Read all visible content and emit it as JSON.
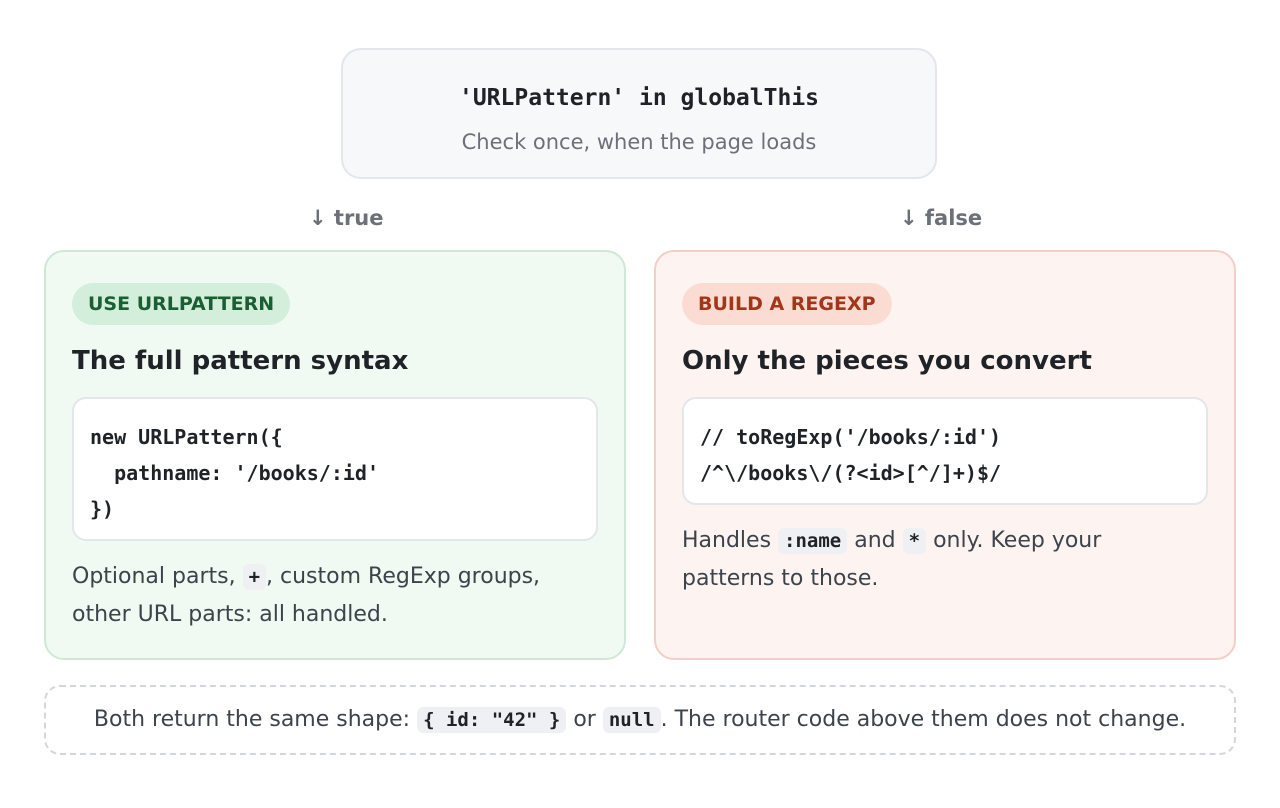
{
  "top": {
    "code": "'URLPattern' in globalThis",
    "subtitle": "Check once, when the page loads"
  },
  "branches": {
    "true_label": "↓ true",
    "false_label": "↓ false"
  },
  "left_panel": {
    "pill": "USE URLPATTERN",
    "title": "The full pattern syntax",
    "code_lines": [
      "new URLPattern({",
      "  pathname: '/books/:id'",
      "})"
    ],
    "text_before": "Optional parts, ",
    "text_chip": "+",
    "text_after": ", custom RegExp groups, other URL parts: all handled."
  },
  "right_panel": {
    "pill": "BUILD A REGEXP",
    "title": "Only the pieces you convert",
    "code_lines": [
      "// toRegExp('/books/:id')",
      "/^\\/books\\/(?<id>[^/]+)$/"
    ],
    "text_before": "Handles ",
    "text_chip1": ":name",
    "text_mid": " and ",
    "text_chip2": "*",
    "text_after": " only. Keep your patterns to those."
  },
  "note": {
    "before": "Both return the same shape: ",
    "chip1": "{ id: \"42\" }",
    "mid": " or ",
    "chip2": "null",
    "after": ". The router code above them does not change."
  },
  "colors": {
    "true_accent": "#1b5e33",
    "false_accent": "#a2361a"
  }
}
